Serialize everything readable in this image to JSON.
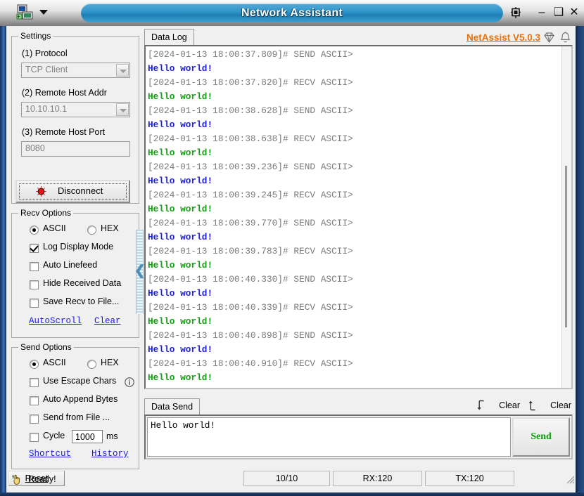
{
  "window": {
    "title": "Network Assistant",
    "app_icon": "network-app-icon",
    "dropdown_icon": "chevron-down-icon",
    "pin_icon": "pin-icon",
    "minimize_label": "–",
    "maximize_label": "❑",
    "close_label": "✕"
  },
  "settings": {
    "group_title": "Settings",
    "protocol_label": "(1) Protocol",
    "protocol_value": "TCP Client",
    "host_label": "(2) Remote Host Addr",
    "host_value": "10.10.10.1",
    "port_label": "(3) Remote Host Port",
    "port_value": "8080",
    "connect_button": "Disconnect",
    "led_icon": "red-led-icon"
  },
  "recv_options": {
    "group_title": "Recv Options",
    "ascii_label": "ASCII",
    "hex_label": "HEX",
    "ascii_selected": true,
    "checkboxes": [
      {
        "label": "Log Display Mode",
        "checked": true
      },
      {
        "label": "Auto Linefeed",
        "checked": false
      },
      {
        "label": "Hide Received Data",
        "checked": false
      },
      {
        "label": "Save Recv to File...",
        "checked": false
      }
    ],
    "autoscroll_link": "AutoScroll",
    "clear_link": "Clear"
  },
  "send_options": {
    "group_title": "Send Options",
    "ascii_label": "ASCII",
    "hex_label": "HEX",
    "ascii_selected": true,
    "checkboxes": [
      {
        "label": "Use Escape Chars",
        "checked": false,
        "info_icon": "info-icon"
      },
      {
        "label": "Auto Append Bytes",
        "checked": false
      },
      {
        "label": "Send from File ...",
        "checked": false
      }
    ],
    "cycle_label": "Cycle",
    "cycle_value": "1000",
    "cycle_unit": "ms",
    "cycle_checked": false,
    "shortcut_link": "Shortcut",
    "history_link": "History"
  },
  "data_log": {
    "tab_label": "Data Log",
    "brand_link": "NetAssist V5.0.3",
    "gem_icon": "gem-icon",
    "bell_icon": "bell-icon",
    "lines": [
      {
        "type": "ts",
        "text": "[2024-01-13 18:00:37.809]# SEND ASCII>"
      },
      {
        "type": "send",
        "text": "Hello world!"
      },
      {
        "type": "ts",
        "text": "[2024-01-13 18:00:37.820]# RECV ASCII>"
      },
      {
        "type": "recv",
        "text": "Hello world!"
      },
      {
        "type": "ts",
        "text": "[2024-01-13 18:00:38.628]# SEND ASCII>"
      },
      {
        "type": "send",
        "text": "Hello world!"
      },
      {
        "type": "ts",
        "text": "[2024-01-13 18:00:38.638]# RECV ASCII>"
      },
      {
        "type": "recv",
        "text": "Hello world!"
      },
      {
        "type": "ts",
        "text": "[2024-01-13 18:00:39.236]# SEND ASCII>"
      },
      {
        "type": "send",
        "text": "Hello world!"
      },
      {
        "type": "ts",
        "text": "[2024-01-13 18:00:39.245]# RECV ASCII>"
      },
      {
        "type": "recv",
        "text": "Hello world!"
      },
      {
        "type": "ts",
        "text": "[2024-01-13 18:00:39.770]# SEND ASCII>"
      },
      {
        "type": "send",
        "text": "Hello world!"
      },
      {
        "type": "ts",
        "text": "[2024-01-13 18:00:39.783]# RECV ASCII>"
      },
      {
        "type": "recv",
        "text": "Hello world!"
      },
      {
        "type": "ts",
        "text": "[2024-01-13 18:00:40.330]# SEND ASCII>"
      },
      {
        "type": "send",
        "text": "Hello world!"
      },
      {
        "type": "ts",
        "text": "[2024-01-13 18:00:40.339]# RECV ASCII>"
      },
      {
        "type": "recv",
        "text": "Hello world!"
      },
      {
        "type": "ts",
        "text": "[2024-01-13 18:00:40.898]# SEND ASCII>"
      },
      {
        "type": "send",
        "text": "Hello world!"
      },
      {
        "type": "ts",
        "text": "[2024-01-13 18:00:40.910]# RECV ASCII>"
      },
      {
        "type": "recv",
        "text": "Hello world!"
      }
    ]
  },
  "data_send": {
    "tab_label": "Data Send",
    "clear_recv_label": "Clear",
    "clear_send_label": "Clear",
    "clear_down_icon": "arrow-down-icon",
    "clear_up_icon": "arrow-up-icon",
    "text_value": "Hello world!",
    "send_button": "Send"
  },
  "statusbar": {
    "status_icon": "hand-pointer-icon",
    "status_text": "Ready!",
    "count": "10/10",
    "rx": "RX:120",
    "tx": "TX:120",
    "reset_button": "Reset",
    "resize_grip_icon": "resize-grip-icon"
  },
  "colors": {
    "brand_orange": "#e8720c",
    "title_blue": "#2e94c9",
    "send_green": "#0a9b0a",
    "msg_send_blue": "#1f1fe0",
    "msg_recv_green": "#12a012",
    "timestamp_gray": "#7b7b7b",
    "link_blue": "#1a1ae6",
    "frame_blue": "#24508f"
  }
}
